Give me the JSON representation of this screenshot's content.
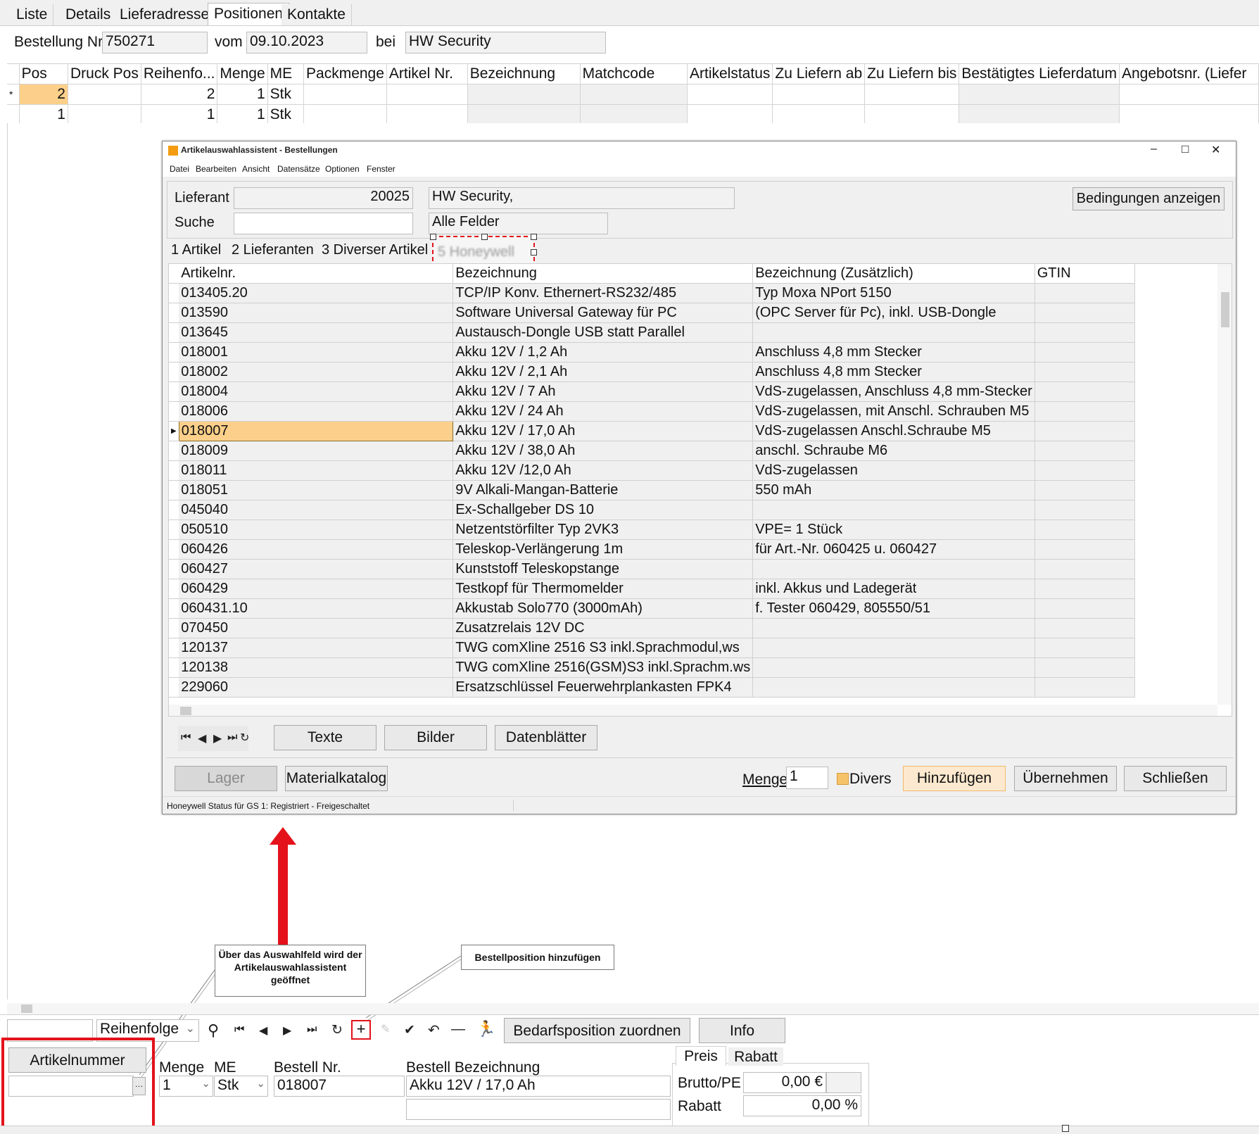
{
  "main_tabs": [
    "Liste",
    "Details",
    "Lieferadresse",
    "Positionen",
    "Kontakte"
  ],
  "order": {
    "nr_label": "Bestellung Nr",
    "nr_value": "750271",
    "date_label": "vom",
    "date_value": "09.10.2023",
    "supplier_label": "bei",
    "supplier_value": "HW Security"
  },
  "positions_table": {
    "columns": [
      "Pos",
      "Druck Pos",
      "Reihenfo...",
      "Menge",
      "ME",
      "Packmenge",
      "Artikel Nr.",
      "Bezeichnung",
      "Matchcode",
      "Artikelstatus",
      "Zu Liefern ab",
      "Zu Liefern bis",
      "Bestätigtes Lieferdatum",
      "Angebotsnr. (Liefer"
    ],
    "rows": [
      {
        "pos": "2",
        "reihenfolge": "2",
        "menge": "1",
        "me": "Stk",
        "marker": "*"
      },
      {
        "pos": "1",
        "reihenfolge": "1",
        "menge": "1",
        "me": "Stk",
        "marker": ""
      }
    ]
  },
  "dialog": {
    "title": "Artikelauswahlassistent - Bestellungen",
    "window_controls": [
      "–",
      "□",
      "✕"
    ],
    "menu": [
      "Datei",
      "Bearbeiten",
      "Ansicht",
      "Datensätze",
      "Optionen",
      "Fenster"
    ],
    "lieferant_label": "Lieferant",
    "lieferant_nr": "20025",
    "lieferant_name": "HW Security,",
    "suche_label": "Suche",
    "suche_value": "",
    "suche_scope": "Alle Felder",
    "bedingungen_button": "Bedingungen anzeigen",
    "tabs": [
      "1 Artikel",
      "2 Lieferanten",
      "3 Diverser Artikel",
      "5 Honeywell"
    ],
    "grid_columns": [
      "Artikelnr.",
      "Bezeichnung",
      "Bezeichnung (Zusätzlich)",
      "GTIN"
    ],
    "grid_rows": [
      [
        "013405.20",
        "TCP/IP Konv. Ethernert-RS232/485",
        "Typ Moxa NPort 5150"
      ],
      [
        "013590",
        "Software Universal Gateway für PC",
        "(OPC Server für Pc), inkl. USB-Dongle"
      ],
      [
        "013645",
        "Austausch-Dongle USB statt Parallel",
        ""
      ],
      [
        "018001",
        "Akku 12V / 1,2 Ah",
        "Anschluss 4,8 mm Stecker"
      ],
      [
        "018002",
        "Akku 12V / 2,1 Ah",
        "Anschluss 4,8 mm Stecker"
      ],
      [
        "018004",
        "Akku 12V / 7 Ah",
        "VdS-zugelassen, Anschluss 4,8 mm-Stecker"
      ],
      [
        "018006",
        "Akku 12V / 24 Ah",
        "VdS-zugelassen, mit Anschl. Schrauben M5"
      ],
      [
        "018007",
        "Akku 12V / 17,0 Ah",
        "VdS-zugelassen  Anschl.Schraube M5"
      ],
      [
        "018009",
        "Akku 12V / 38,0 Ah",
        "anschl. Schraube M6"
      ],
      [
        "018011",
        "Akku 12V /12,0 Ah",
        "VdS-zugelassen"
      ],
      [
        "018051",
        "9V Alkali-Mangan-Batterie",
        "550 mAh"
      ],
      [
        "045040",
        "Ex-Schallgeber DS 10",
        ""
      ],
      [
        "050510",
        "Netzentstörfilter Typ 2VK3",
        "VPE= 1 Stück"
      ],
      [
        "060426",
        "Teleskop-Verlängerung 1m",
        " für Art.-Nr. 060425 u. 060427"
      ],
      [
        "060427",
        "Kunststoff Teleskopstange",
        ""
      ],
      [
        "060429",
        "Testkopf für Thermomelder",
        "inkl. Akkus und Ladegerät"
      ],
      [
        "060431.10",
        "Akkustab Solo770 (3000mAh)",
        "f. Tester 060429, 805550/51"
      ],
      [
        "070450",
        "Zusatzrelais 12V DC",
        ""
      ],
      [
        "120137",
        "TWG comXline 2516 S3 inkl.Sprachmodul,ws",
        ""
      ],
      [
        "120138",
        "TWG comXline 2516(GSM)S3 inkl.Sprachm.ws",
        ""
      ],
      [
        "229060",
        "Ersatzschlüssel Feuerwehrplankasten FPK4",
        ""
      ]
    ],
    "selected_index": 7,
    "texte_button": "Texte",
    "bilder_button": "Bilder",
    "datenblaetter_button": "Datenblätter",
    "lager_button": "Lager",
    "materialkatalog_button": "Materialkatalog",
    "menge_label": "Menge",
    "menge_value": "1",
    "divers_label": "Divers",
    "hinzufuegen_button": "Hinzufügen",
    "uebernehmen_button": "Übernehmen",
    "schliessen_button": "Schließen",
    "status": "Honeywell Status für GS 1: Registriert - Freigeschaltet"
  },
  "annotations": {
    "note1": "Über das Auswahlfeld wird der Artikelauswahlassistent geöffnet",
    "note2": "Bestellposition hinzufügen"
  },
  "bottom": {
    "sort_value": "Reihenfolge",
    "bedarf_button": "Bedarfsposition zuordnen",
    "info_button": "Info",
    "artikelnummer_button": "Artikelnummer",
    "artikelnummer_value": "",
    "menge_label": "Menge",
    "menge_value": "1",
    "me_label": "ME",
    "me_value": "Stk",
    "bestell_nr_label": "Bestell Nr.",
    "bestell_nr_value": "018007",
    "bestell_bez_label": "Bestell Bezeichnung",
    "bestell_bez_value": "Akku 12V / 17,0 Ah",
    "preis_tab": "Preis",
    "rabatt_tab": "Rabatt",
    "brutto_label": "Brutto/PE",
    "brutto_value": "0,00 €",
    "rabatt_label": "Rabatt",
    "rabatt_value": "0,00 %"
  },
  "colors": {
    "selection": "#fcd08a",
    "highlight_red": "#e3121b",
    "window_bg": "#f0f0f0"
  }
}
